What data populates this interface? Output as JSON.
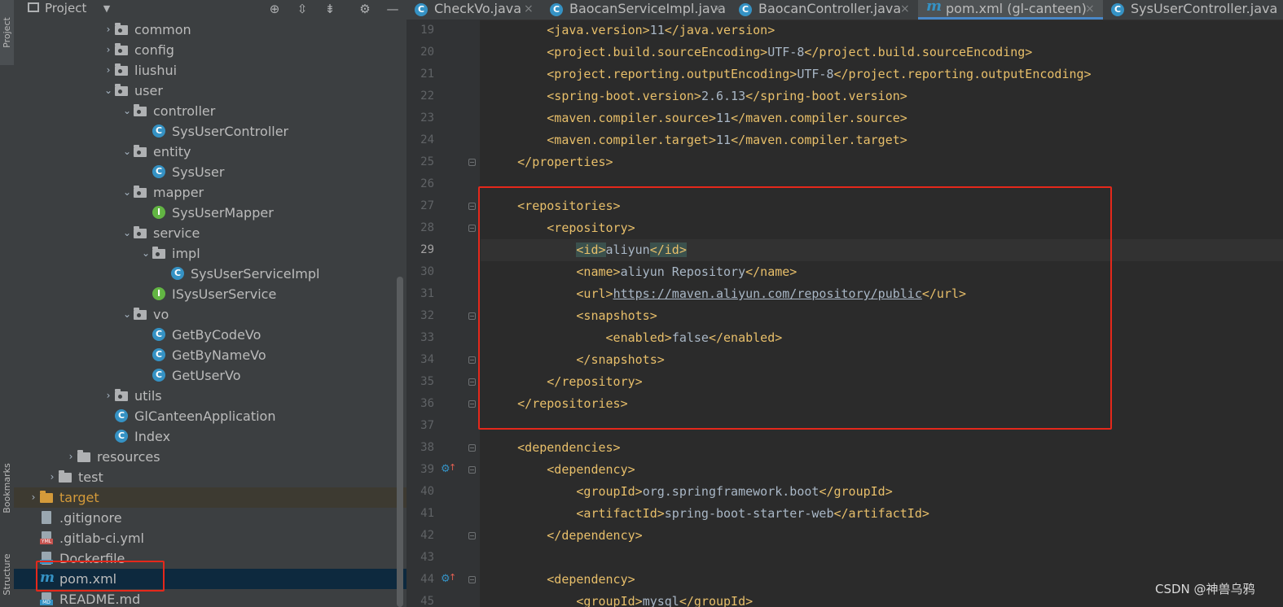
{
  "sidebar_strip": {
    "project_label": "Project",
    "bookmarks_label": "Bookmarks",
    "structure_label": "Structure"
  },
  "project_panel": {
    "title": "Project",
    "icons": [
      "target-icon",
      "expand-all-icon",
      "collapse-all-icon",
      "gear-icon",
      "minimize-icon"
    ],
    "tree": [
      {
        "label": "common",
        "type": "package",
        "arrow": "›",
        "level": 5
      },
      {
        "label": "config",
        "type": "package",
        "arrow": "›",
        "level": 5
      },
      {
        "label": "liushui",
        "type": "package",
        "arrow": "›",
        "level": 5
      },
      {
        "label": "user",
        "type": "package",
        "arrow": "⌄",
        "level": 5
      },
      {
        "label": "controller",
        "type": "package",
        "arrow": "⌄",
        "level": 6
      },
      {
        "label": "SysUserController",
        "type": "class",
        "arrow": "",
        "level": 7
      },
      {
        "label": "entity",
        "type": "package",
        "arrow": "⌄",
        "level": 6
      },
      {
        "label": "SysUser",
        "type": "class",
        "arrow": "",
        "level": 7
      },
      {
        "label": "mapper",
        "type": "package",
        "arrow": "⌄",
        "level": 6
      },
      {
        "label": "SysUserMapper",
        "type": "interface",
        "arrow": "",
        "level": 7
      },
      {
        "label": "service",
        "type": "package",
        "arrow": "⌄",
        "level": 6
      },
      {
        "label": "impl",
        "type": "package",
        "arrow": "⌄",
        "level": 7
      },
      {
        "label": "SysUserServiceImpl",
        "type": "class",
        "arrow": "",
        "level": 8
      },
      {
        "label": "ISysUserService",
        "type": "interface",
        "arrow": "",
        "level": 7
      },
      {
        "label": "vo",
        "type": "package",
        "arrow": "⌄",
        "level": 6
      },
      {
        "label": "GetByCodeVo",
        "type": "class",
        "arrow": "",
        "level": 7
      },
      {
        "label": "GetByNameVo",
        "type": "class",
        "arrow": "",
        "level": 7
      },
      {
        "label": "GetUserVo",
        "type": "class",
        "arrow": "",
        "level": 7
      },
      {
        "label": "utils",
        "type": "package",
        "arrow": "›",
        "level": 5
      },
      {
        "label": "GlCanteenApplication",
        "type": "class",
        "arrow": "",
        "level": 5
      },
      {
        "label": "Index",
        "type": "class",
        "arrow": "",
        "level": 5
      },
      {
        "label": "resources",
        "type": "folder",
        "arrow": "›",
        "level": 3
      },
      {
        "label": "test",
        "type": "folder",
        "arrow": "›",
        "level": 2
      },
      {
        "label": "target",
        "type": "excluded",
        "arrow": "›",
        "level": 1
      },
      {
        "label": ".gitignore",
        "type": "file",
        "arrow": "",
        "level": 1
      },
      {
        "label": ".gitlab-ci.yml",
        "type": "yml",
        "arrow": "",
        "level": 1
      },
      {
        "label": "Dockerfile",
        "type": "docker",
        "arrow": "",
        "level": 1
      },
      {
        "label": "pom.xml",
        "type": "maven",
        "arrow": "",
        "level": 1,
        "selected": true
      },
      {
        "label": "README.md",
        "type": "md",
        "arrow": "",
        "level": 1
      }
    ]
  },
  "tabs": [
    {
      "label": "CheckVo.java",
      "icon": "class",
      "active": false
    },
    {
      "label": "BaocanServiceImpl.java",
      "icon": "class",
      "active": false
    },
    {
      "label": "BaocanController.java",
      "icon": "class",
      "active": false
    },
    {
      "label": "pom.xml (gl-canteen)",
      "icon": "maven",
      "active": true
    },
    {
      "label": "SysUserController.java",
      "icon": "class",
      "active": false
    }
  ],
  "tab_close_glyph": "×",
  "maven_glyph": "m",
  "code": [
    {
      "n": "19",
      "indent": 2,
      "tag": "java.version",
      "value": "11"
    },
    {
      "n": "20",
      "indent": 2,
      "tag": "project.build.sourceEncoding",
      "value": "UTF-8"
    },
    {
      "n": "21",
      "indent": 2,
      "tag": "project.reporting.outputEncoding",
      "value": "UTF-8"
    },
    {
      "n": "22",
      "indent": 2,
      "tag": "spring-boot.version",
      "value": "2.6.13"
    },
    {
      "n": "23",
      "indent": 2,
      "tag": "maven.compiler.source",
      "value": "11"
    },
    {
      "n": "24",
      "indent": 2,
      "tag": "maven.compiler.target",
      "value": "11"
    },
    {
      "n": "25",
      "indent": 1,
      "close": "properties",
      "fold": true
    },
    {
      "n": "26",
      "indent": 0
    },
    {
      "n": "27",
      "indent": 1,
      "open": "repositories",
      "fold": true
    },
    {
      "n": "28",
      "indent": 2,
      "open": "repository",
      "fold": true
    },
    {
      "n": "29",
      "indent": 3,
      "tag": "id",
      "value": "aliyun",
      "current": true,
      "highlight": true
    },
    {
      "n": "30",
      "indent": 3,
      "tag": "name",
      "value": "aliyun Repository"
    },
    {
      "n": "31",
      "indent": 3,
      "tag": "url",
      "value": "https://maven.aliyun.com/repository/public",
      "link": true
    },
    {
      "n": "32",
      "indent": 3,
      "open": "snapshots",
      "fold": true
    },
    {
      "n": "33",
      "indent": 4,
      "tag": "enabled",
      "value": "false"
    },
    {
      "n": "34",
      "indent": 3,
      "close": "snapshots",
      "fold": true
    },
    {
      "n": "35",
      "indent": 2,
      "close": "repository",
      "fold": true
    },
    {
      "n": "36",
      "indent": 1,
      "close": "repositories",
      "fold": true
    },
    {
      "n": "37",
      "indent": 0
    },
    {
      "n": "38",
      "indent": 1,
      "open": "dependencies",
      "fold": true
    },
    {
      "n": "39",
      "indent": 2,
      "open": "dependency",
      "fold": true,
      "marker": true
    },
    {
      "n": "40",
      "indent": 3,
      "tag": "groupId",
      "value": "org.springframework.boot"
    },
    {
      "n": "41",
      "indent": 3,
      "tag": "artifactId",
      "value": "spring-boot-starter-web"
    },
    {
      "n": "42",
      "indent": 2,
      "close": "dependency",
      "fold": true
    },
    {
      "n": "43",
      "indent": 0
    },
    {
      "n": "44",
      "indent": 2,
      "open": "dependency",
      "fold": true,
      "marker": true
    },
    {
      "n": "45",
      "indent": 3,
      "tag": "groupId",
      "value": "mysql"
    }
  ],
  "watermark": "CSDN @神兽乌鸦",
  "colors": {
    "tag": "#e8bf6a",
    "text": "#a9b7c6",
    "annotation_box": "#e5281b",
    "active_tab_underline": "#4a88c7",
    "selection": "#0d293e"
  }
}
